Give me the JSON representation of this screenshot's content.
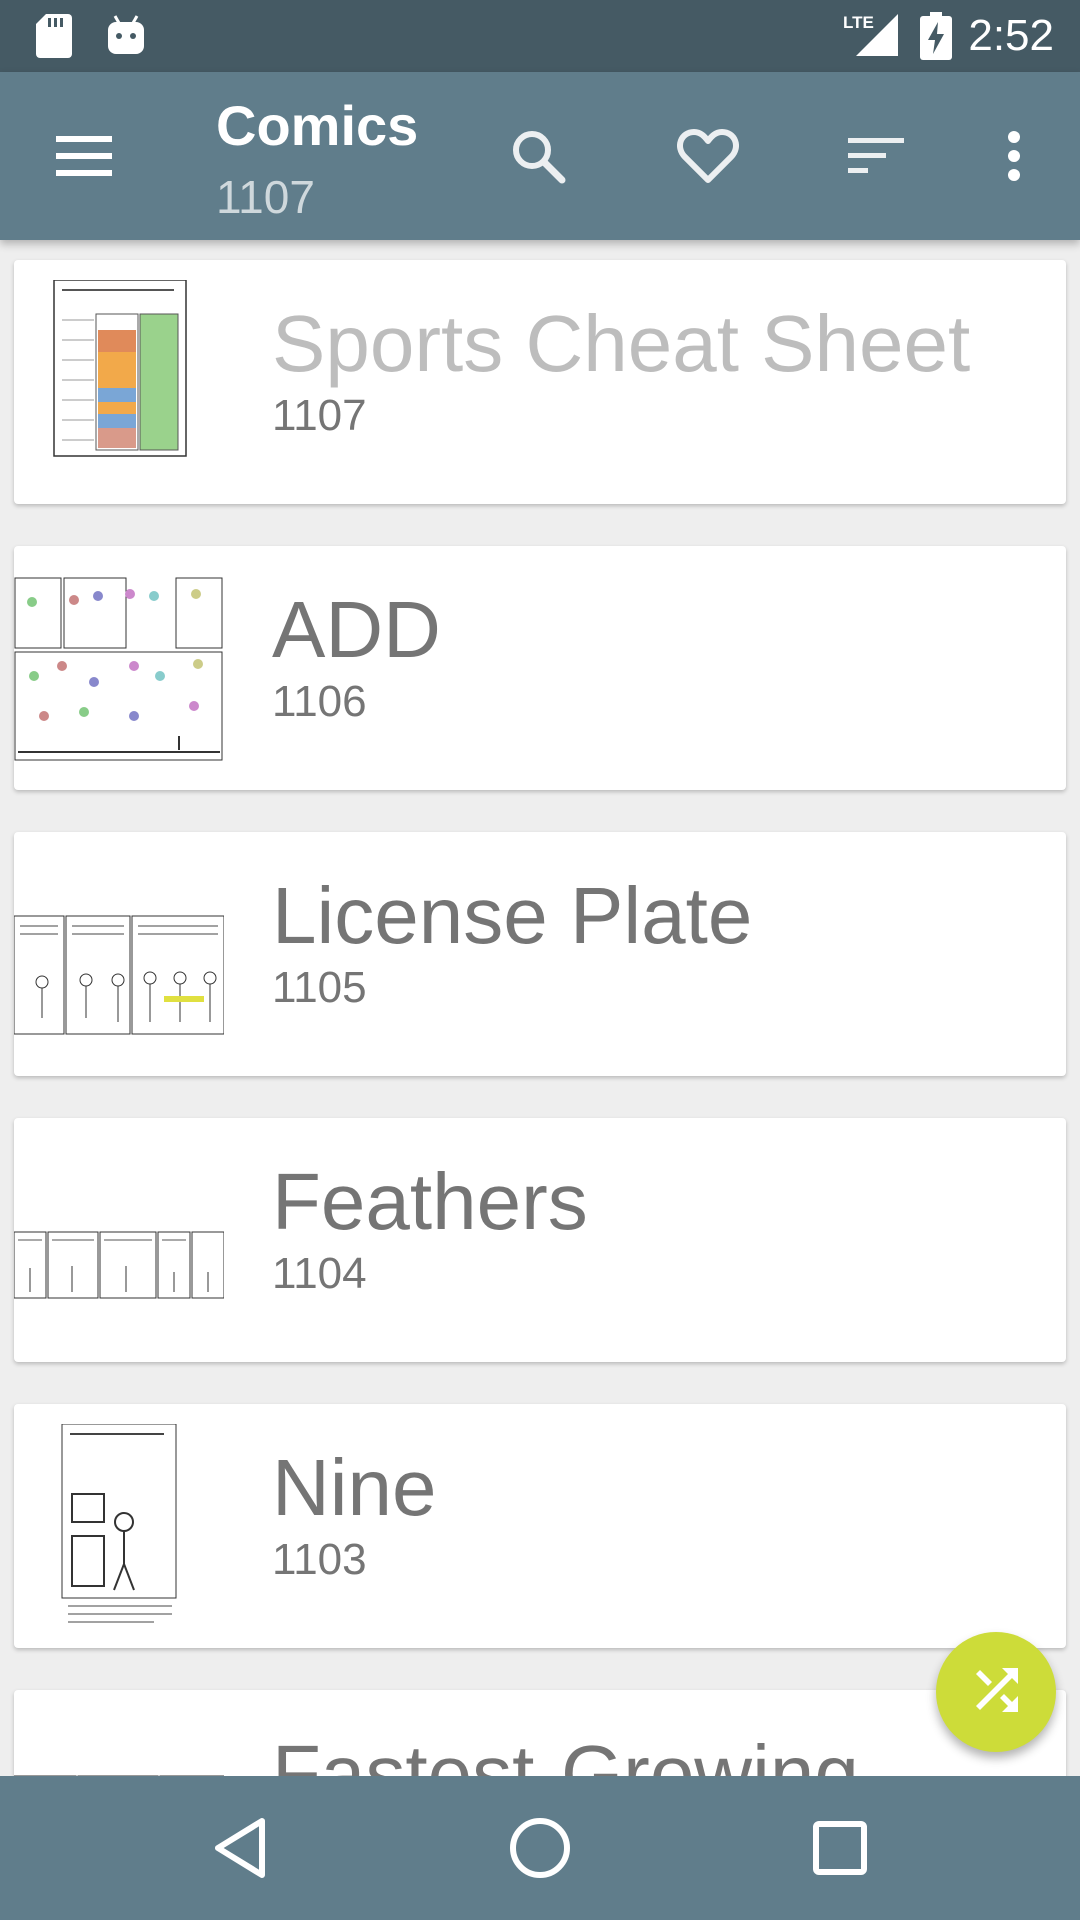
{
  "status_bar": {
    "time": "2:52",
    "network": "LTE",
    "icons": [
      "sd-card-icon",
      "android-debug-icon",
      "lte-signal-icon",
      "battery-charging-icon"
    ]
  },
  "app_bar": {
    "title": "Comics",
    "subtitle": "1107",
    "actions": [
      "menu-icon",
      "search-icon",
      "favorite-icon",
      "sort-icon",
      "more-vert-icon"
    ],
    "colors": {
      "app_bar": "#607d8b",
      "status_bar": "#455a64",
      "fab": "#cddc39"
    }
  },
  "comics": [
    {
      "title": "Sports Cheat Sheet",
      "number": "1107"
    },
    {
      "title": "ADD",
      "number": "1106"
    },
    {
      "title": "License Plate",
      "number": "1105"
    },
    {
      "title": "Feathers",
      "number": "1104"
    },
    {
      "title": "Nine",
      "number": "1103"
    },
    {
      "title": "Fastest-Growing",
      "number": ""
    }
  ],
  "fab": {
    "icon": "shuffle-icon"
  },
  "nav_bar": {
    "buttons": [
      "back-icon",
      "home-icon",
      "recents-icon"
    ]
  }
}
